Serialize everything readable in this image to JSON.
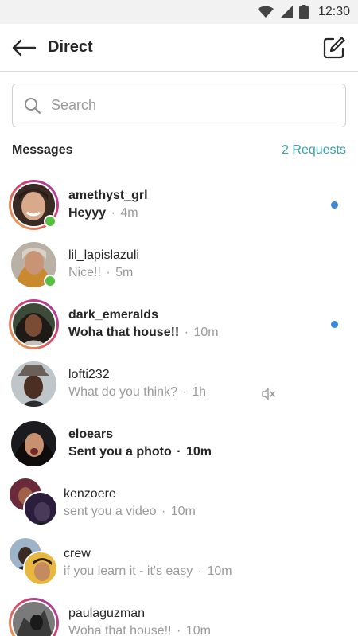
{
  "status_bar": {
    "time": "12:30"
  },
  "header": {
    "title": "Direct"
  },
  "search": {
    "placeholder": "Search"
  },
  "messages_section": {
    "title": "Messages",
    "requests": "2 Requests"
  },
  "colors": {
    "accent": "#3aa0a8",
    "unread_dot": "#3b89d6",
    "online": "#57c042"
  },
  "threads": [
    {
      "username": "amethyst_grl",
      "preview": "Heyyy",
      "time": "4m"
    },
    {
      "username": "lil_lapislazuli",
      "preview": "Nice!!",
      "time": "5m"
    },
    {
      "username": "dark_emeralds",
      "preview": "Woha that house!!",
      "time": "10m"
    },
    {
      "username": "lofti232",
      "preview": "What do you think?",
      "time": "1h"
    },
    {
      "username": "eloears",
      "preview": "Sent you a photo",
      "time": "10m"
    },
    {
      "username": "kenzoere",
      "preview": "sent you a video",
      "time": "10m"
    },
    {
      "username": "crew",
      "preview": "if you learn it - it's easy",
      "time": "10m"
    },
    {
      "username": "paulaguzman",
      "preview": "Woha that house!!",
      "time": "10m"
    }
  ]
}
